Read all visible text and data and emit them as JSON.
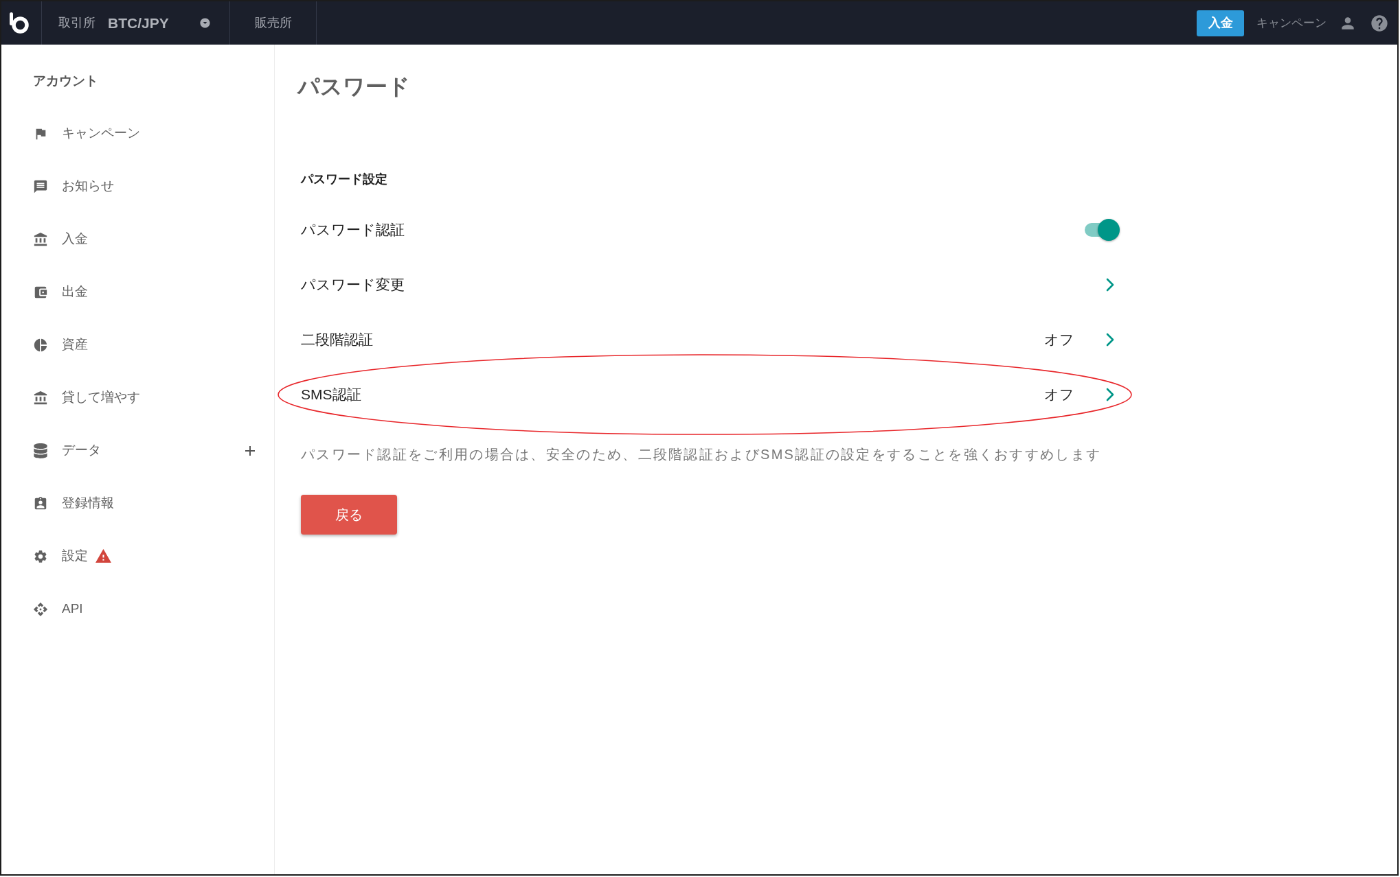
{
  "top_bar": {
    "exchange_label": "取引所",
    "pair": "BTC/JPY",
    "store_link": "販売所",
    "deposit_button": "入金",
    "campaign_link": "キャンペーン"
  },
  "sidebar": {
    "heading": "アカウント",
    "items": [
      {
        "label": "キャンペーン",
        "kind": "link",
        "warning": false
      },
      {
        "label": "お知らせ",
        "kind": "link",
        "warning": false
      },
      {
        "label": "入金",
        "kind": "link",
        "warning": false
      },
      {
        "label": "出金",
        "kind": "link",
        "warning": false
      },
      {
        "label": "資産",
        "kind": "link",
        "warning": false
      },
      {
        "label": "貸して増やす",
        "kind": "link",
        "warning": false
      },
      {
        "label": "データ",
        "kind": "group",
        "expanded": false,
        "warning": false
      },
      {
        "label": "登録情報",
        "kind": "link",
        "warning": false
      },
      {
        "label": "設定",
        "kind": "link",
        "warning": true
      },
      {
        "label": "API",
        "kind": "link",
        "warning": false
      }
    ]
  },
  "main": {
    "title": "パスワード",
    "section_title": "パスワード設定",
    "rows": [
      {
        "kind": "toggle",
        "label": "パスワード認証",
        "on": true,
        "highlighted": false
      },
      {
        "kind": "link",
        "label": "パスワード変更",
        "highlighted": false
      },
      {
        "kind": "link",
        "label": "二段階認証",
        "value": "オフ",
        "highlighted": false
      },
      {
        "kind": "link",
        "label": "SMS認証",
        "value": "オフ",
        "highlighted": true
      }
    ],
    "note": "パスワード認証をご利用の場合は、安全のため、二段階認証およびSMS認証の設定をすることを強くおすすめします",
    "back_button": "戻る"
  }
}
